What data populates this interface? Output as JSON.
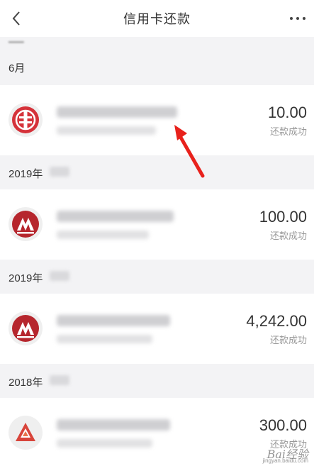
{
  "header": {
    "title": "信用卡还款"
  },
  "sections": [
    {
      "label": "6月",
      "row": {
        "bank_icon": "citic-bank-logo",
        "amount": "10.00",
        "status": "还款成功"
      }
    },
    {
      "label": "2019年",
      "row": {
        "bank_icon": "cmb-bank-logo",
        "amount": "100.00",
        "status": "还款成功"
      }
    },
    {
      "label": "2019年",
      "row": {
        "bank_icon": "cmb-bank-logo",
        "amount": "4,242.00",
        "status": "还款成功"
      }
    },
    {
      "label": "2018年",
      "row": {
        "bank_icon": "pingan-bank-logo",
        "amount": "300.00",
        "status": "还款成功"
      }
    }
  ],
  "watermark": {
    "brand": "Bai经验",
    "url": "jingyan.baidu.com"
  },
  "colors": {
    "citic_red": "#d5323a",
    "cmb_red": "#b6262d",
    "pingan_red": "#d8443a",
    "arrow_red": "#e8211c"
  }
}
